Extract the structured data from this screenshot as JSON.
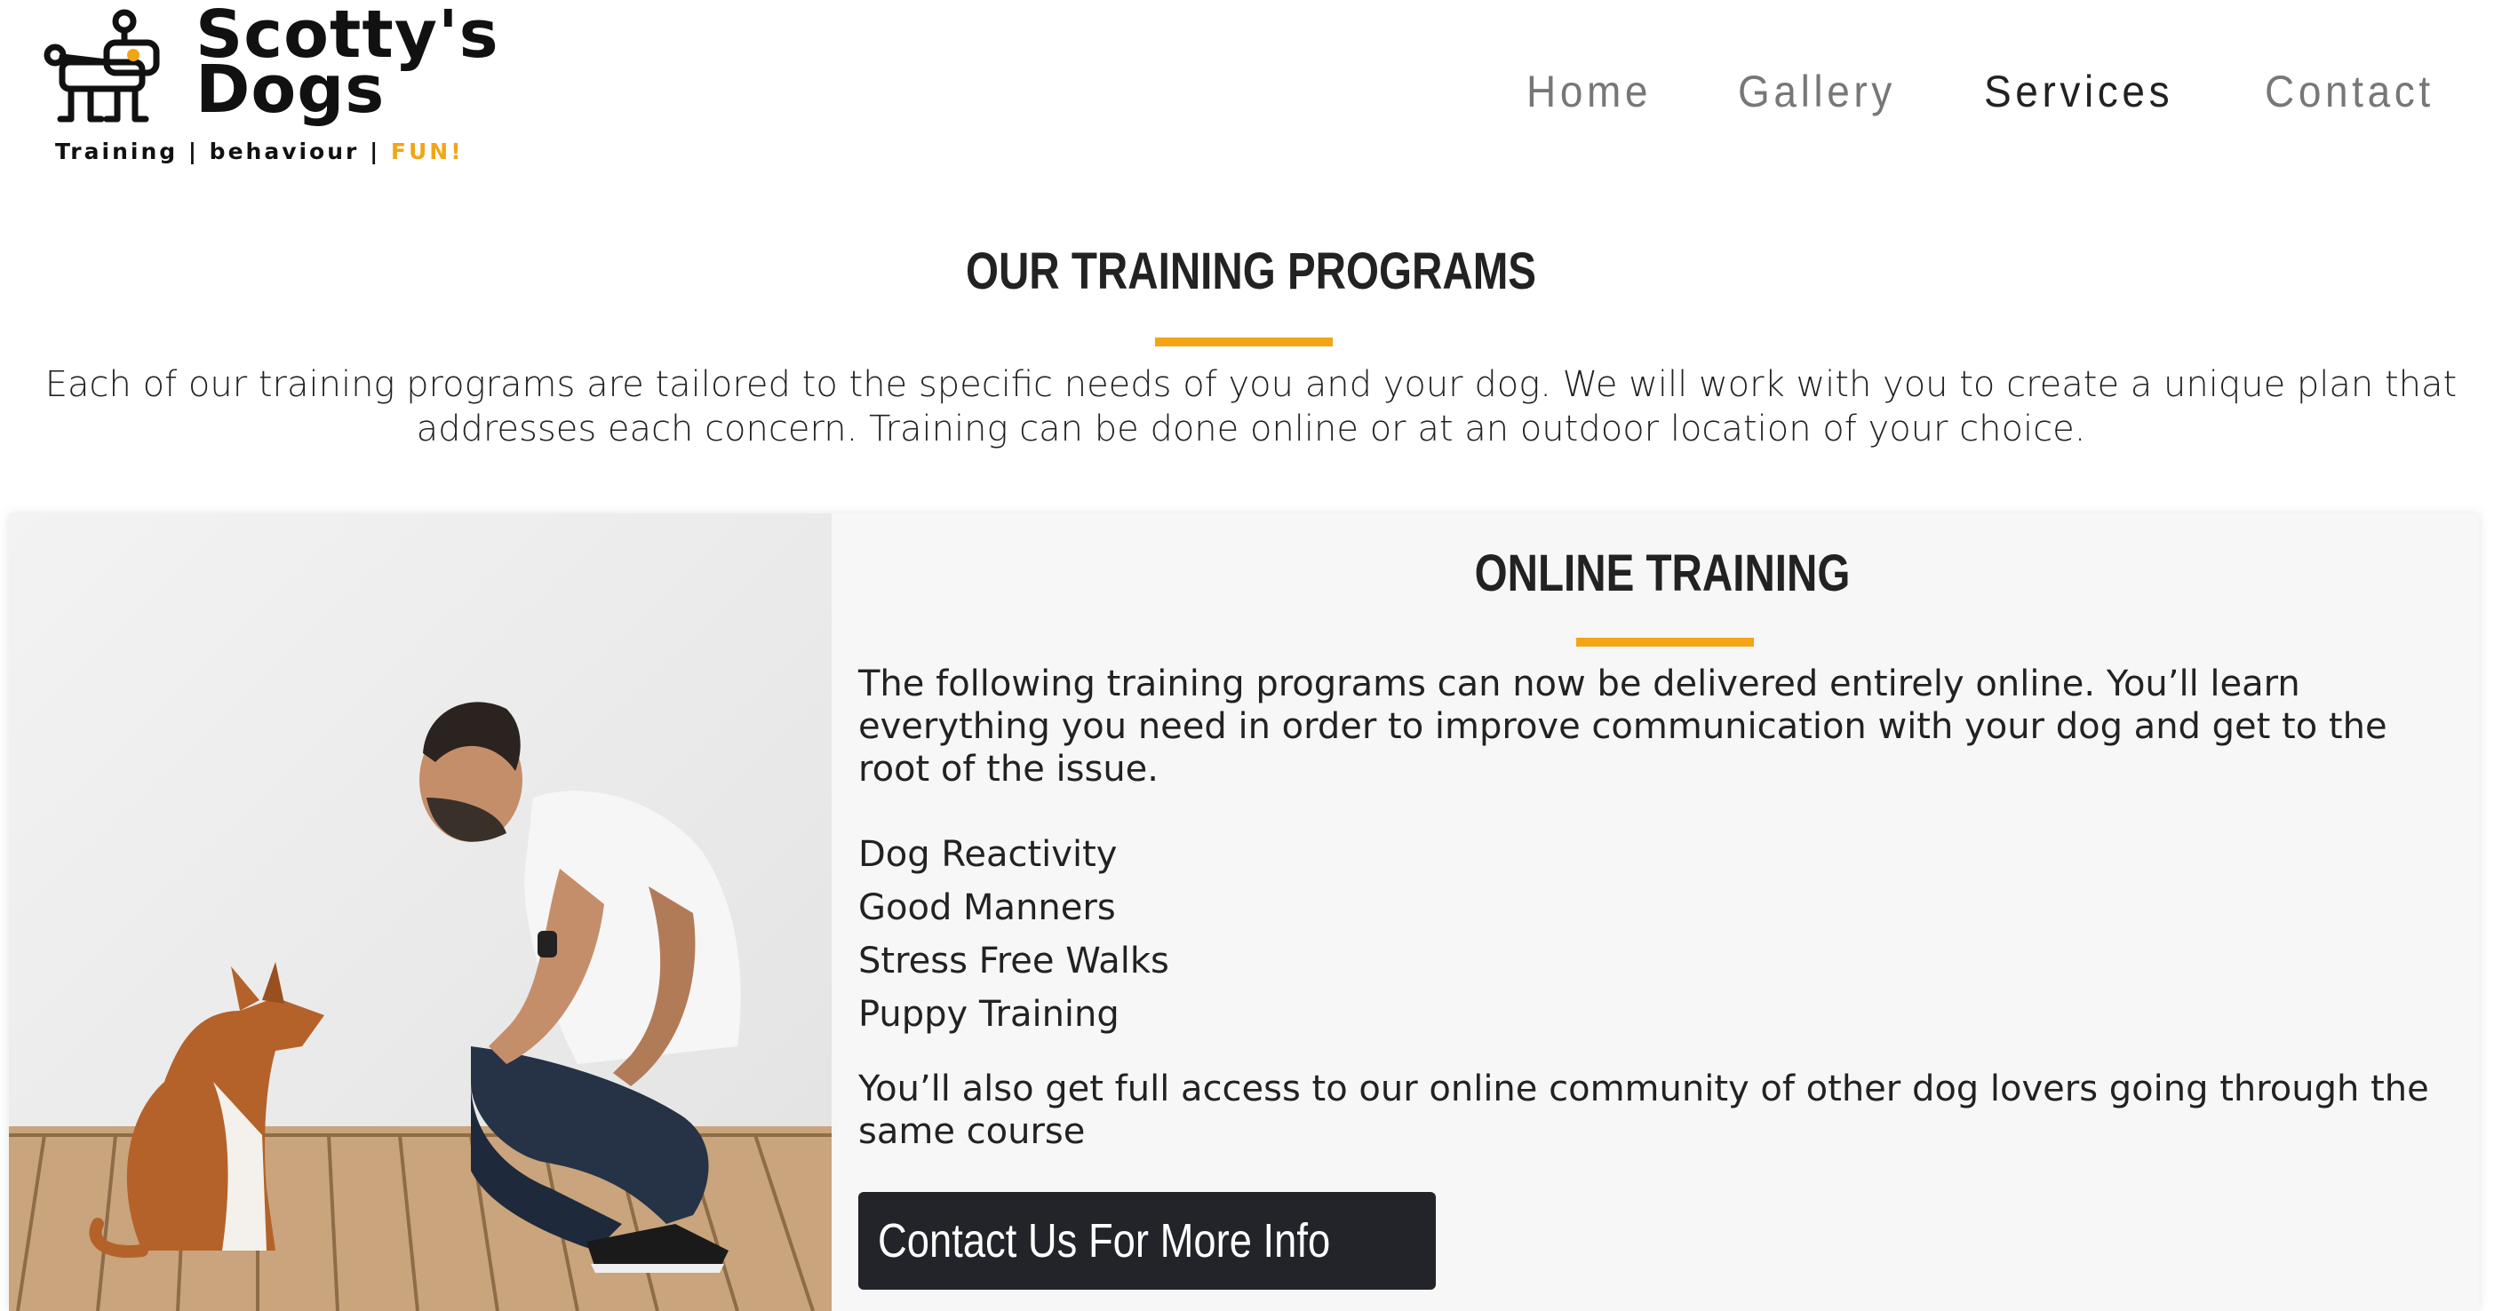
{
  "logo": {
    "name_line1": "Scotty's",
    "name_line2": "Dogs",
    "tagline_main": "Training | behaviour | ",
    "tagline_fun": "FUN!",
    "accent_color": "#f2a516"
  },
  "nav": {
    "items": [
      {
        "label": "Home",
        "active": false
      },
      {
        "label": "Gallery",
        "active": false
      },
      {
        "label": "Services",
        "active": true
      },
      {
        "label": "Contact",
        "active": false
      }
    ]
  },
  "intro": {
    "title": "OUR TRAINING PROGRAMS",
    "text": "Each of our training programs are tailored to the specific needs of you and your dog. We will work with you to create a unique plan that addresses each concern. Training can be done online or at an outdoor location of your choice."
  },
  "online": {
    "title": "ONLINE TRAINING",
    "description": "The following training programs can now be delivered entirely online. You’ll learn everything you need in order to improve communication with your dog and get to the root of the issue.",
    "programs": [
      "Dog Reactivity",
      "Good Manners",
      "Stress Free Walks",
      "Puppy Training"
    ],
    "extra": "You’ll also get full access to our online community of other dog lovers going through the same course",
    "cta_label": "Contact Us For More Info"
  },
  "icons": {
    "logo": "robot-dog-logo-icon"
  }
}
